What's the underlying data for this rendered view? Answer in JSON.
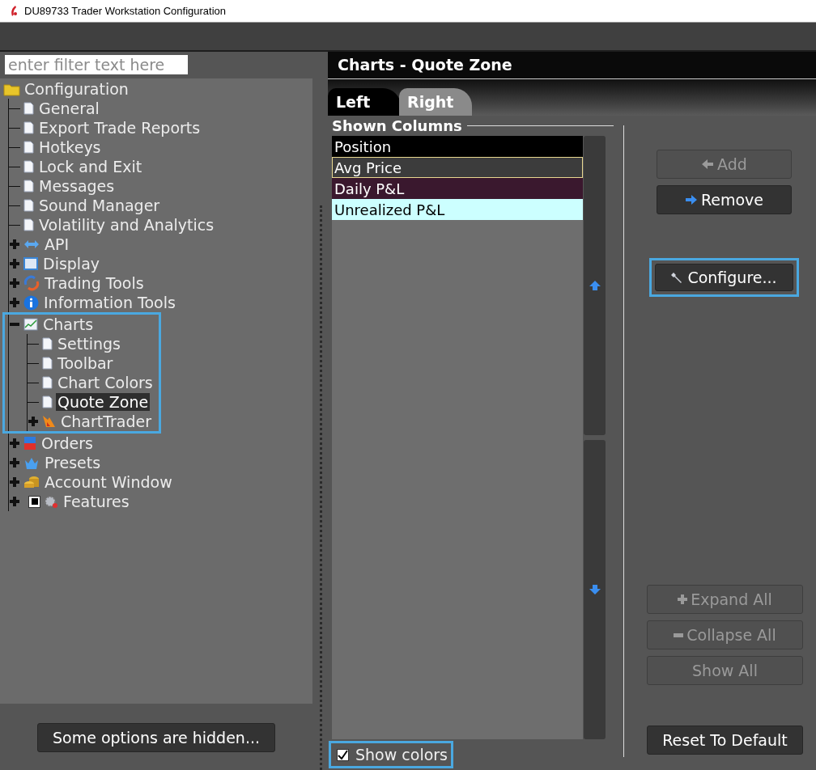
{
  "window": {
    "title": "DU89733 Trader Workstation Configuration"
  },
  "filter": {
    "placeholder": "enter filter text here"
  },
  "tree": [
    {
      "label": "Configuration",
      "kind": "folder",
      "selected": false,
      "children": [
        {
          "label": "General",
          "kind": "page",
          "selected": false
        },
        {
          "label": "Export Trade Reports",
          "kind": "page",
          "selected": false
        },
        {
          "label": "Hotkeys",
          "kind": "page",
          "selected": false
        },
        {
          "label": "Lock and Exit",
          "kind": "page",
          "selected": false
        },
        {
          "label": "Messages",
          "kind": "page",
          "selected": false
        },
        {
          "label": "Sound Manager",
          "kind": "page",
          "selected": false
        },
        {
          "label": "Volatility and Analytics",
          "kind": "page",
          "selected": false
        },
        {
          "label": "API",
          "kind": "api",
          "expanded": false,
          "selected": false
        },
        {
          "label": "Display",
          "kind": "display",
          "expanded": false,
          "selected": false
        },
        {
          "label": "Trading Tools",
          "kind": "trading",
          "expanded": false,
          "selected": false
        },
        {
          "label": "Information Tools",
          "kind": "info",
          "expanded": false,
          "selected": false
        },
        {
          "label": "Charts",
          "kind": "chart",
          "expanded": true,
          "selected": false,
          "highlighted": true,
          "children": [
            {
              "label": "Settings",
              "kind": "page",
              "selected": false
            },
            {
              "label": "Toolbar",
              "kind": "page",
              "selected": false
            },
            {
              "label": "Chart Colors",
              "kind": "page",
              "selected": false
            },
            {
              "label": "Quote Zone",
              "kind": "page",
              "selected": true
            },
            {
              "label": "ChartTrader",
              "kind": "flame",
              "expanded": false,
              "selected": false
            }
          ]
        },
        {
          "label": "Orders",
          "kind": "orders",
          "expanded": false,
          "selected": false
        },
        {
          "label": "Presets",
          "kind": "presets",
          "expanded": false,
          "selected": false
        },
        {
          "label": "Account Window",
          "kind": "coins",
          "expanded": false,
          "selected": false
        },
        {
          "label": "Features",
          "kind": "gear",
          "expanded": false,
          "selected": false,
          "partially_checked": true
        }
      ]
    }
  ],
  "hidden_button": "Some options are hidden...",
  "panel": {
    "title": "Charts - Quote Zone",
    "tabs": [
      {
        "label": "Left",
        "selected": true
      },
      {
        "label": "Right",
        "selected": false
      }
    ],
    "shown_columns": {
      "heading": "Shown Columns",
      "items": [
        {
          "label": "Position",
          "color": "#000000",
          "selected": false
        },
        {
          "label": "Avg Price",
          "color": "#3c3c3c",
          "selected": true
        },
        {
          "label": "Daily P&L",
          "color": "#3a182e",
          "selected": false
        },
        {
          "label": "Unrealized P&L",
          "color": "#ccffff",
          "selected": false
        }
      ]
    },
    "buttons": [
      {
        "label": "Add",
        "kind": "add",
        "disabled": true
      },
      {
        "label": "Remove",
        "kind": "remove",
        "disabled": false
      },
      {
        "label": "Configure...",
        "kind": "configure",
        "disabled": false,
        "highlighted": true
      }
    ],
    "tree_buttons": [
      {
        "label": "Expand All",
        "kind": "expand",
        "disabled": true
      },
      {
        "label": "Collapse All",
        "kind": "collapse",
        "disabled": true
      },
      {
        "label": "Show All",
        "kind": "plain",
        "disabled": true
      }
    ],
    "reset_button": "Reset To Default",
    "show_colors": {
      "label": "Show colors",
      "checked": true,
      "highlighted": true
    }
  }
}
